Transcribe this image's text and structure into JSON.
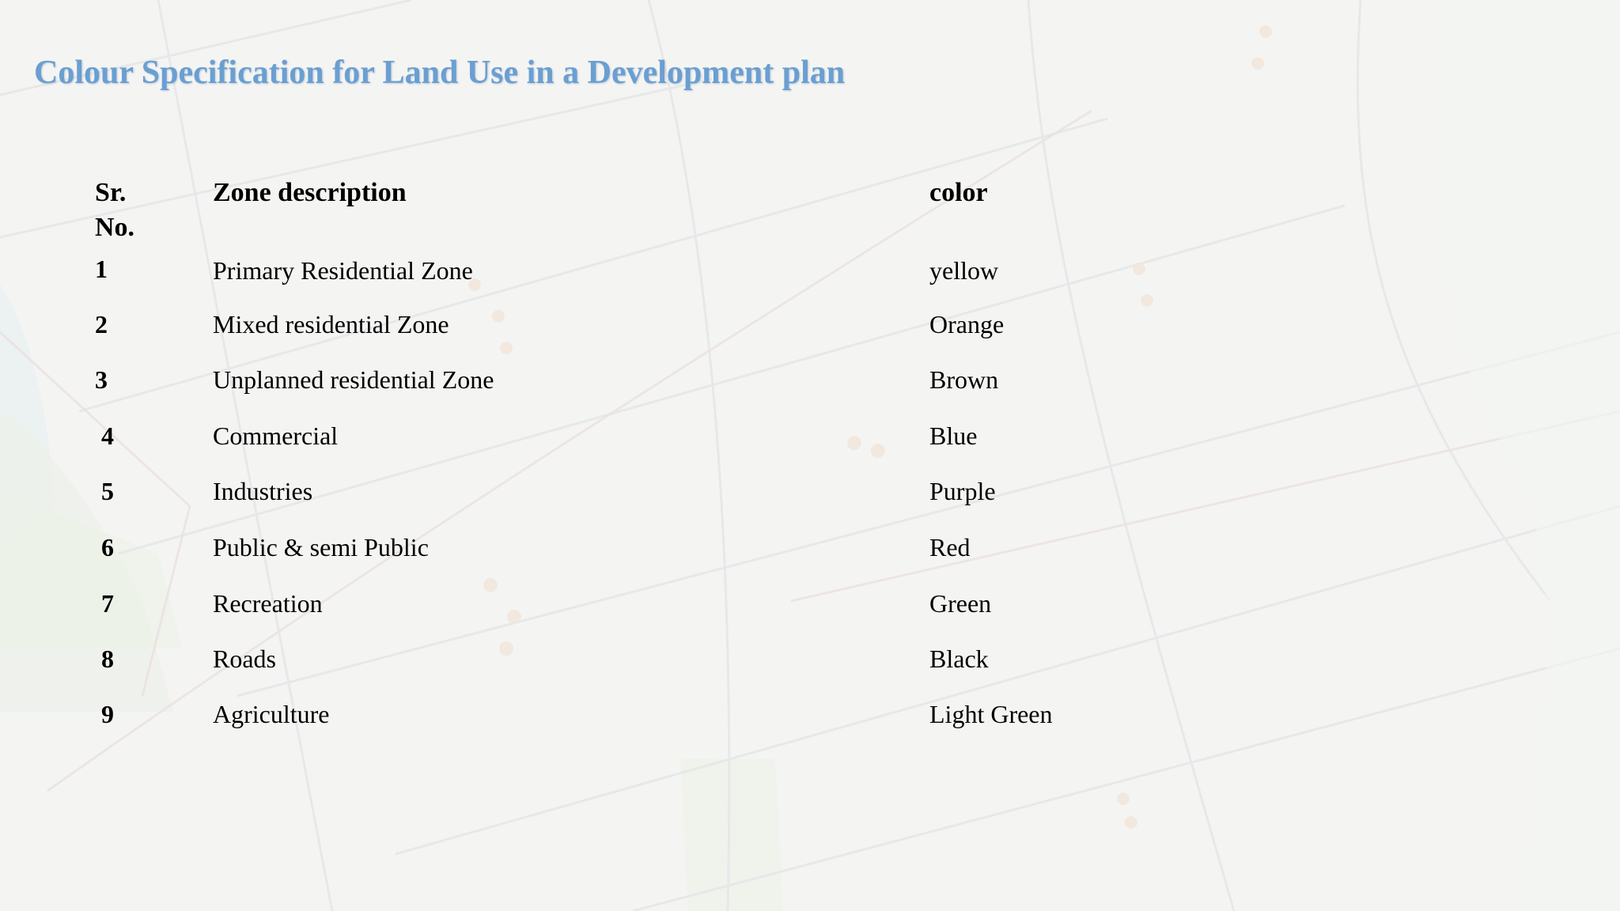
{
  "title": "Colour Specification for Land Use in a Development plan",
  "table": {
    "headers": {
      "sr_line1": "Sr.",
      "sr_line2": "No.",
      "zone": "Zone description",
      "color": "color"
    },
    "rows": [
      {
        "sr": "1",
        "zone": "Primary Residential Zone",
        "color": "yellow"
      },
      {
        "sr": "2",
        "zone": "Mixed residential Zone",
        "color": "Orange"
      },
      {
        "sr": "3",
        "zone": "Unplanned residential Zone",
        "color": "Brown"
      },
      {
        "sr": "4",
        "zone": "Commercial",
        "color": "Blue"
      },
      {
        "sr": "5",
        "zone": "Industries",
        "color": "Purple"
      },
      {
        "sr": "6",
        "zone": "Public & semi Public",
        "color": "Red"
      },
      {
        "sr": "7",
        "zone": "Recreation",
        "color": "Green"
      },
      {
        "sr": "8",
        "zone": "Roads",
        "color": "Black"
      },
      {
        "sr": "9",
        "zone": "Agriculture",
        "color": "Light Green"
      }
    ]
  },
  "colors": {
    "title": "#6a9fd2",
    "text": "#000000",
    "background": "#f4f5f3"
  }
}
